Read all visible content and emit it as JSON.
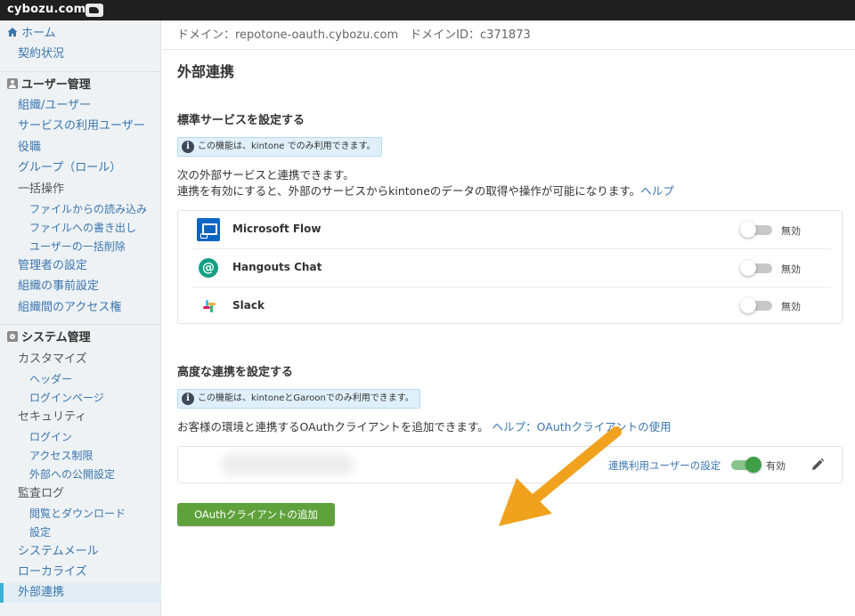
{
  "topbar": {
    "logo": "cybozu.com"
  },
  "sidebar": {
    "home": "ホーム",
    "contract": "契約状況",
    "user_admin_title": "ユーザー管理",
    "user_items": [
      "組織/ユーザー",
      "サービスの利用ユーザー",
      "役職",
      "グループ（ロール）"
    ],
    "bulk_ops": "一括操作",
    "bulk_items": [
      "ファイルからの読み込み",
      "ファイルへの書き出し",
      "ユーザーの一括削除"
    ],
    "admin_items": [
      "管理者の設定",
      "組織の事前設定",
      "組織間のアクセス権"
    ],
    "system_admin_title": "システム管理",
    "customize": "カスタマイズ",
    "customize_items": [
      "ヘッダー",
      "ログインページ"
    ],
    "security": "セキュリティ",
    "security_items": [
      "ログイン",
      "アクセス制限",
      "外部への公開設定"
    ],
    "audit_log": "監査ログ",
    "audit_items": [
      "閲覧とダウンロード",
      "設定"
    ],
    "system_items": [
      "システムメール",
      "ローカライズ"
    ],
    "active_item": "外部連携"
  },
  "main": {
    "domain_line": "ドメイン：repotone-oauth.cybozu.com　ドメインID：c371873",
    "page_title": "外部連携",
    "standard": {
      "title": "標準サービスを設定する",
      "notice": "この機能は、kintone でのみ利用できます。",
      "desc1": "次の外部サービスと連携できます。",
      "desc2": "連携を有効にすると、外部のサービスからkintoneのデータの取得や操作が可能になります。",
      "help": "ヘルプ",
      "services": [
        {
          "name": "Microsoft Flow",
          "icon": "microsoft-flow-icon",
          "state": "無効",
          "enabled": false
        },
        {
          "name": "Hangouts Chat",
          "icon": "hangouts-chat-icon",
          "state": "無効",
          "enabled": false
        },
        {
          "name": "Slack",
          "icon": "slack-icon",
          "state": "無効",
          "enabled": false
        }
      ]
    },
    "advanced": {
      "title": "高度な連携を設定する",
      "notice": "この機能は、kintoneとGaroonでのみ利用できます。",
      "desc": "お客様の環境と連携するOAuthクライアントを追加できます。",
      "help": "ヘルプ：OAuthクライアントの使用",
      "client_user_settings": "連携利用ユーザーの設定",
      "client_state": "有効",
      "client_enabled": true,
      "add_button": "OAuthクライアントの追加"
    }
  },
  "colors": {
    "topbar": "#1f1f1f",
    "sidebar_bg": "#eef2f4",
    "link": "#3a76b1",
    "active_marker": "#3ab0d8",
    "button": "#5fa23b",
    "annotation_arrow": "#f0a21e"
  }
}
